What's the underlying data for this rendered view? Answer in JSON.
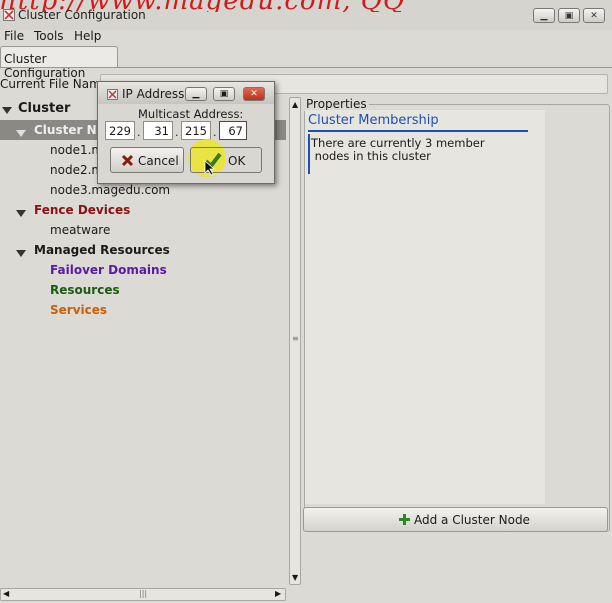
{
  "window": {
    "title": "Cluster Configuration",
    "watermark": "http://www.magedu.com, QQ"
  },
  "menu": [
    {
      "label": "File",
      "mnemonic": "F"
    },
    {
      "label": "Tools",
      "mnemonic": "T"
    },
    {
      "label": "Help",
      "mnemonic": "H"
    }
  ],
  "tab": {
    "label": "Cluster Configuration"
  },
  "file": {
    "label": "Current File Name:",
    "value": ""
  },
  "tree": {
    "cluster": "Cluster",
    "cluster_nodes": "Cluster Nodes",
    "nodes": [
      "node1.magedu.com",
      "node2.magedu.com",
      "node3.magedu.com"
    ],
    "fence_devices": "Fence Devices",
    "fence_items": [
      "meatware"
    ],
    "managed_resources": "Managed Resources",
    "failover_domains": "Failover Domains",
    "resources": "Resources",
    "services": "Services"
  },
  "properties": {
    "legend": "Properties",
    "heading": "Cluster Membership",
    "text_line1": "There are currently 3 member",
    "text_line2": " nodes in this cluster",
    "add_button": "Add a Cluster Node"
  },
  "dialog": {
    "title": "IP Address",
    "label": "Multicast Address:",
    "octets": [
      "229",
      "31",
      "215",
      "67"
    ],
    "cancel": "Cancel",
    "ok": "OK"
  },
  "colors": {
    "fence": "#8b1010",
    "managed": "#111111",
    "failover": "#5a1aa8",
    "resources": "#1a5a12",
    "services": "#c8600a",
    "accent": "#1e4fb0"
  }
}
